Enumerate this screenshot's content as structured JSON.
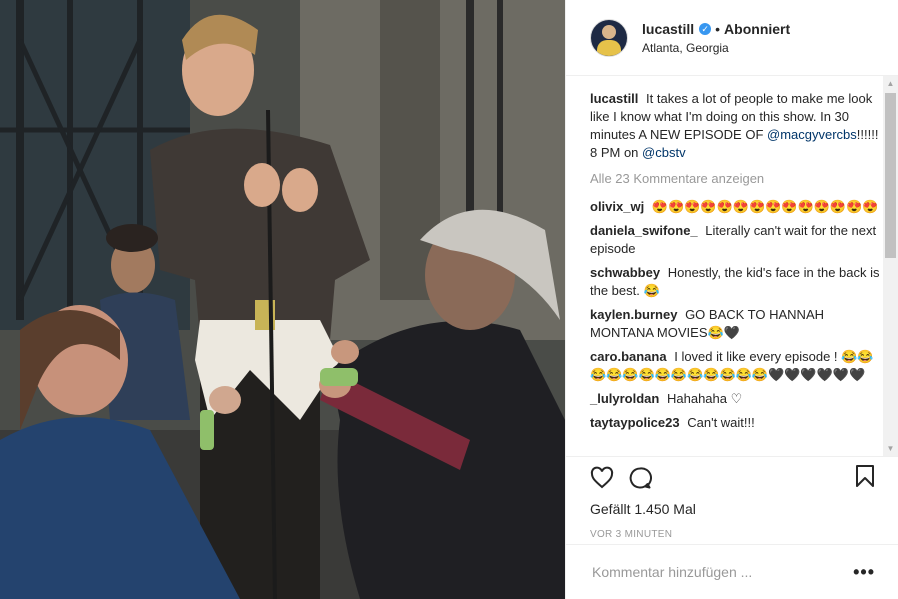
{
  "post": {
    "username": "lucastill",
    "follow_label": "Abonniert",
    "location": "Atlanta, Georgia",
    "caption": {
      "user": "lucastill",
      "text_1": "It takes a lot of people to make me look like I know what I'm doing on this show. In 30 minutes A NEW EPISODE OF",
      "mention_1": "@macgyvercbs",
      "text_2": "!!!!!! 8 PM on",
      "mention_2": "@cbstv"
    },
    "view_all_label": "Alle 23 Kommentare anzeigen",
    "comments": [
      {
        "user": "olivix_wj",
        "text": "😍😍😍😍😍😍😍😍😍😍😍😍😍😍"
      },
      {
        "user": "daniela_swifone_",
        "text": "Literally can't wait for the next episode"
      },
      {
        "user": "schwabbey",
        "text": "Honestly, the kid's face in the back is the best. 😂"
      },
      {
        "user": "kaylen.burney",
        "text": "GO BACK TO HANNAH MONTANA MOVIES😂🖤"
      },
      {
        "user": "caro.banana",
        "text": "I loved it like every episode ! 😂😂😂😂😂😂😂😂😂😂😂😂😂🖤🖤🖤🖤🖤🖤"
      },
      {
        "user": "_lulyroldan",
        "text": "Hahahaha ♡"
      },
      {
        "user": "taytaypolice23",
        "text": "Can't wait!!!"
      }
    ],
    "likes_label": "Gefällt 1.450 Mal",
    "time_label": "VOR 3 MINUTEN",
    "comment_placeholder": "Kommentar hinzufügen ...",
    "more_label": "•••"
  },
  "icons": {
    "verified": "verified-badge-icon",
    "like": "heart-icon",
    "comment": "comment-bubble-icon",
    "save": "bookmark-icon",
    "scroll_up": "▲",
    "scroll_down": "▼"
  },
  "colors": {
    "link": "#003569",
    "muted": "#999999",
    "verified": "#3897f0"
  }
}
